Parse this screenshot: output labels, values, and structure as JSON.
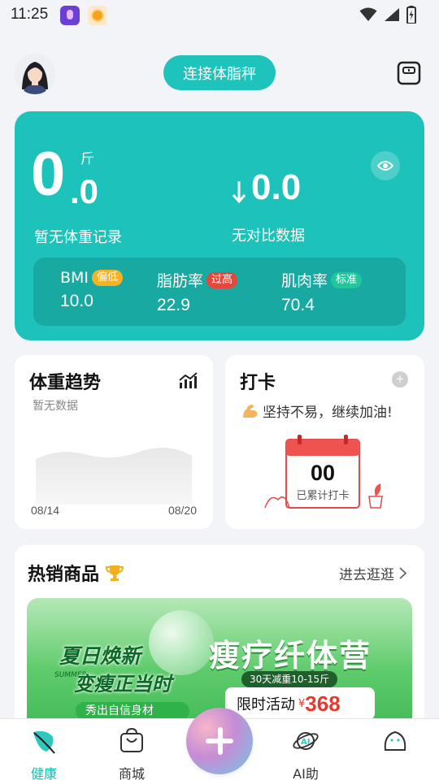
{
  "status_bar": {
    "time": "11:25"
  },
  "header": {
    "connect_button": "连接体脂秤"
  },
  "weight": {
    "integer": "0",
    "decimal": ".0",
    "unit": "斤",
    "note": "暂无体重记录",
    "diff_value": "0.0",
    "diff_note": "无对比数据"
  },
  "metrics": [
    {
      "label": "BMI",
      "tag": "偏低",
      "value": "10.0"
    },
    {
      "label": "脂肪率",
      "tag": "过高",
      "value": "22.9"
    },
    {
      "label": "肌肉率",
      "tag": "标准",
      "value": "70.4"
    }
  ],
  "trend": {
    "title": "体重趋势",
    "subtitle": "暂无数据",
    "date_start": "08/14",
    "date_end": "08/20"
  },
  "checkin": {
    "title": "打卡",
    "cheer": "坚持不易，继续加油!",
    "count": "00",
    "count_label": "已累计打卡"
  },
  "hot": {
    "title": "热销商品",
    "more": "进去逛逛",
    "banner": {
      "left_title": "夏日焕新",
      "left_sub": "变瘦正当时",
      "summer": "SUMMER",
      "strip": "秀出自信身材",
      "right_title": "瘦疗纤体营",
      "pill": "30天减重10-15斤",
      "limited": "限时活动",
      "currency": "¥",
      "price": "368"
    }
  },
  "nav": {
    "items": [
      {
        "label": "健康"
      },
      {
        "label": "商城"
      },
      {
        "label": "AI助"
      },
      {
        "label": ""
      }
    ]
  },
  "colors": {
    "accent": "#1dc2ba",
    "accent_dark": "#18a9a2"
  }
}
